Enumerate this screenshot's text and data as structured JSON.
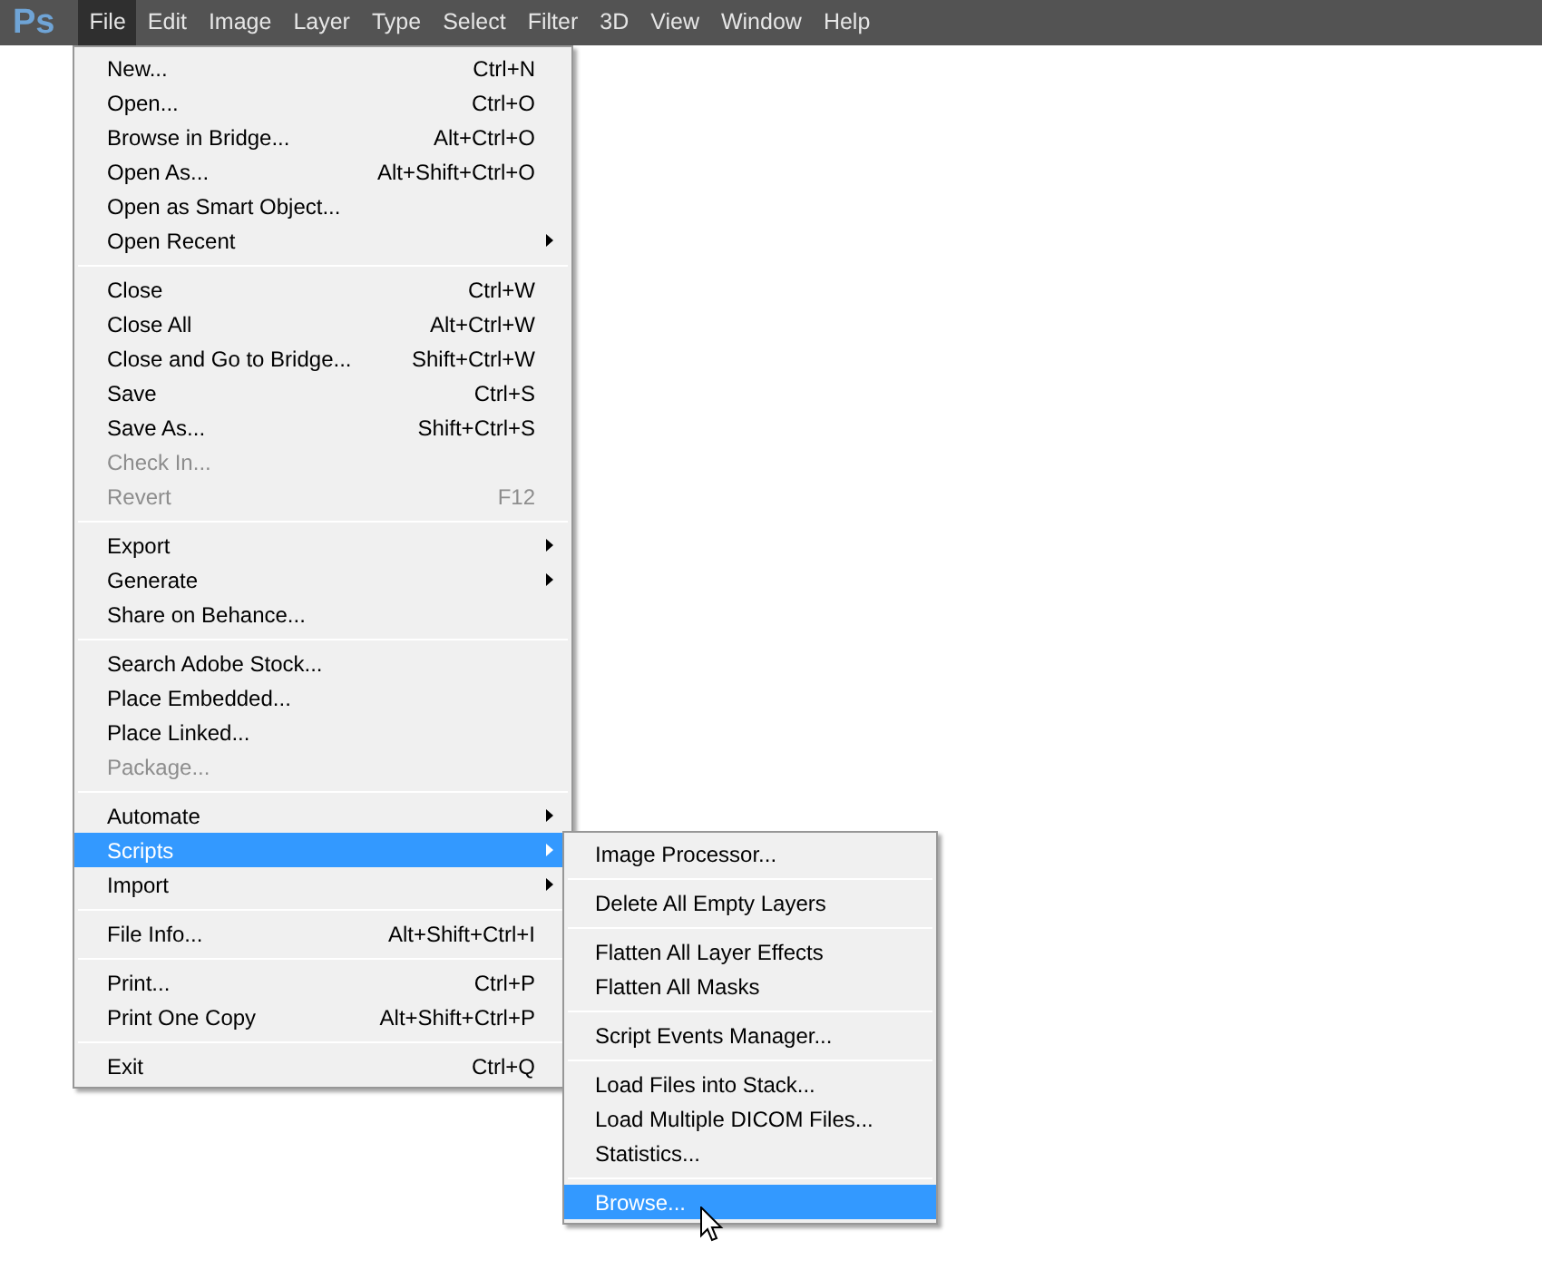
{
  "app_logo": "Ps",
  "menubar": [
    {
      "label": "File",
      "selected": true
    },
    {
      "label": "Edit",
      "selected": false
    },
    {
      "label": "Image",
      "selected": false
    },
    {
      "label": "Layer",
      "selected": false
    },
    {
      "label": "Type",
      "selected": false
    },
    {
      "label": "Select",
      "selected": false
    },
    {
      "label": "Filter",
      "selected": false
    },
    {
      "label": "3D",
      "selected": false
    },
    {
      "label": "View",
      "selected": false
    },
    {
      "label": "Window",
      "selected": false
    },
    {
      "label": "Help",
      "selected": false
    }
  ],
  "file_menu": [
    [
      {
        "label": "New...",
        "shortcut": "Ctrl+N",
        "submenu": false,
        "disabled": false,
        "selected": false
      },
      {
        "label": "Open...",
        "shortcut": "Ctrl+O",
        "submenu": false,
        "disabled": false,
        "selected": false
      },
      {
        "label": "Browse in Bridge...",
        "shortcut": "Alt+Ctrl+O",
        "submenu": false,
        "disabled": false,
        "selected": false
      },
      {
        "label": "Open As...",
        "shortcut": "Alt+Shift+Ctrl+O",
        "submenu": false,
        "disabled": false,
        "selected": false
      },
      {
        "label": "Open as Smart Object...",
        "submenu": false,
        "disabled": false,
        "selected": false
      },
      {
        "label": "Open Recent",
        "submenu": true,
        "disabled": false,
        "selected": false
      }
    ],
    [
      {
        "label": "Close",
        "shortcut": "Ctrl+W",
        "submenu": false,
        "disabled": false,
        "selected": false
      },
      {
        "label": "Close All",
        "shortcut": "Alt+Ctrl+W",
        "submenu": false,
        "disabled": false,
        "selected": false
      },
      {
        "label": "Close and Go to Bridge...",
        "shortcut": "Shift+Ctrl+W",
        "submenu": false,
        "disabled": false,
        "selected": false
      },
      {
        "label": "Save",
        "shortcut": "Ctrl+S",
        "submenu": false,
        "disabled": false,
        "selected": false
      },
      {
        "label": "Save As...",
        "shortcut": "Shift+Ctrl+S",
        "submenu": false,
        "disabled": false,
        "selected": false
      },
      {
        "label": "Check In...",
        "submenu": false,
        "disabled": true,
        "selected": false
      },
      {
        "label": "Revert",
        "shortcut": "F12",
        "submenu": false,
        "disabled": true,
        "selected": false
      }
    ],
    [
      {
        "label": "Export",
        "submenu": true,
        "disabled": false,
        "selected": false
      },
      {
        "label": "Generate",
        "submenu": true,
        "disabled": false,
        "selected": false
      },
      {
        "label": "Share on Behance...",
        "submenu": false,
        "disabled": false,
        "selected": false
      }
    ],
    [
      {
        "label": "Search Adobe Stock...",
        "submenu": false,
        "disabled": false,
        "selected": false
      },
      {
        "label": "Place Embedded...",
        "submenu": false,
        "disabled": false,
        "selected": false
      },
      {
        "label": "Place Linked...",
        "submenu": false,
        "disabled": false,
        "selected": false
      },
      {
        "label": "Package...",
        "submenu": false,
        "disabled": true,
        "selected": false
      }
    ],
    [
      {
        "label": "Automate",
        "submenu": true,
        "disabled": false,
        "selected": false
      },
      {
        "label": "Scripts",
        "submenu": true,
        "disabled": false,
        "selected": true
      },
      {
        "label": "Import",
        "submenu": true,
        "disabled": false,
        "selected": false
      }
    ],
    [
      {
        "label": "File Info...",
        "shortcut": "Alt+Shift+Ctrl+I",
        "submenu": false,
        "disabled": false,
        "selected": false
      }
    ],
    [
      {
        "label": "Print...",
        "shortcut": "Ctrl+P",
        "submenu": false,
        "disabled": false,
        "selected": false
      },
      {
        "label": "Print One Copy",
        "shortcut": "Alt+Shift+Ctrl+P",
        "submenu": false,
        "disabled": false,
        "selected": false
      }
    ],
    [
      {
        "label": "Exit",
        "shortcut": "Ctrl+Q",
        "submenu": false,
        "disabled": false,
        "selected": false
      }
    ]
  ],
  "scripts_menu": [
    [
      {
        "label": "Image Processor...",
        "selected": false
      }
    ],
    [
      {
        "label": "Delete All Empty Layers",
        "selected": false
      }
    ],
    [
      {
        "label": "Flatten All Layer Effects",
        "selected": false
      },
      {
        "label": "Flatten All Masks",
        "selected": false
      }
    ],
    [
      {
        "label": "Script Events Manager...",
        "selected": false
      }
    ],
    [
      {
        "label": "Load Files into Stack...",
        "selected": false
      },
      {
        "label": "Load Multiple DICOM Files...",
        "selected": false
      },
      {
        "label": "Statistics...",
        "selected": false
      }
    ],
    [
      {
        "label": "Browse...",
        "selected": true
      }
    ]
  ]
}
